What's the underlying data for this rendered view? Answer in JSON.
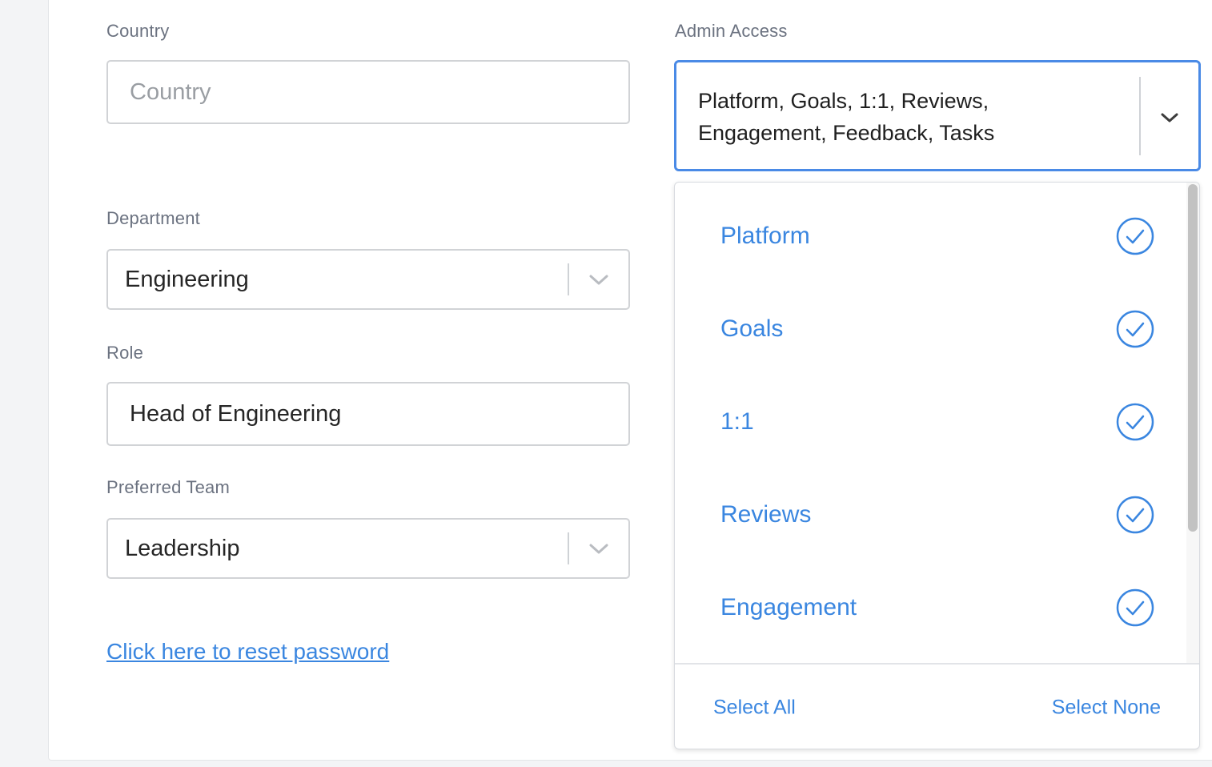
{
  "form": {
    "country": {
      "label": "Country",
      "placeholder": "Country",
      "value": ""
    },
    "department": {
      "label": "Department",
      "value": "Engineering"
    },
    "role": {
      "label": "Role",
      "value": "Head of Engineering"
    },
    "preferred_team": {
      "label": "Preferred Team",
      "value": "Leadership"
    },
    "reset_password_link": "Click here to reset password"
  },
  "admin_access": {
    "label": "Admin Access",
    "selected_value": "Platform, Goals, 1:1, Reviews, Engagement, Feedback, Tasks",
    "options": [
      {
        "label": "Platform",
        "checked": true
      },
      {
        "label": "Goals",
        "checked": true
      },
      {
        "label": "1:1",
        "checked": true
      },
      {
        "label": "Reviews",
        "checked": true
      },
      {
        "label": "Engagement",
        "checked": true
      }
    ],
    "select_all_label": "Select All",
    "select_none_label": "Select None"
  },
  "icons": {
    "dropdown": "chevron-down-icon",
    "checked": "check-circle-icon"
  },
  "colors": {
    "accent": "#3a86e0",
    "focus_border": "#4a8ae6",
    "label": "#6b7280",
    "field_border": "#d1d3d6"
  }
}
